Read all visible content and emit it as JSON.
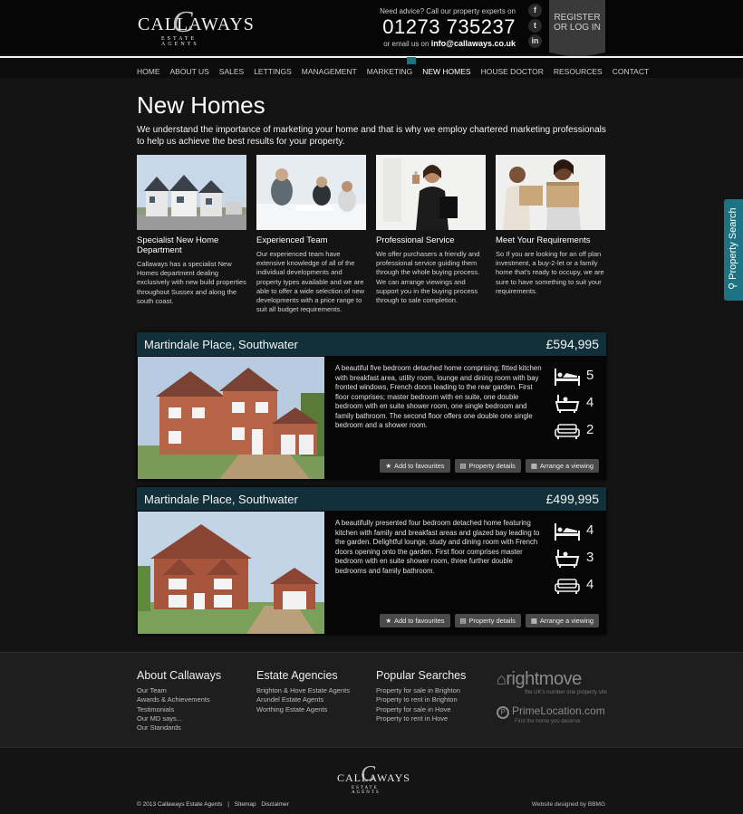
{
  "brand": {
    "logo_main": "CALLAWAYS",
    "logo_sub": "ESTATE AGENTS",
    "logo_swash": "C"
  },
  "header": {
    "advice": "Need advice? Call our property experts on",
    "phone": "01273 735237",
    "email_prefix": "or email us on",
    "email": "info@callaways.co.uk",
    "register_line1": "REGISTER",
    "register_line2": "OR LOG IN",
    "social": [
      "f",
      "t",
      "in"
    ]
  },
  "nav": {
    "items": [
      "HOME",
      "ABOUT US",
      "SALES",
      "LETTINGS",
      "MANAGEMENT",
      "MARKETING",
      "NEW HOMES",
      "HOUSE DOCTOR",
      "RESOURCES",
      "CONTACT"
    ],
    "active": "NEW HOMES"
  },
  "page": {
    "title": "New Homes",
    "intro": "We understand the importance of marketing your home and that is why we employ chartered marketing professionals to help us achieve the best results for your property."
  },
  "features": [
    {
      "title": "Specialist New Home Department",
      "text": "Callaways has a specialist New Homes department dealing exclusively with new build properties throughout Sussex and along the south coast."
    },
    {
      "title": "Experienced Team",
      "text": "Our experienced team have extensive knowledge of all of the individual developments and property types available and we are able to offer a wide selection of new developments with a price range to suit all budget requirements."
    },
    {
      "title": "Professional Service",
      "text": "We offer purchasers a friendly and professional service guiding them through the whole buying process. We can arrange viewings and support you in the buying process through to sale completion."
    },
    {
      "title": "Meet Your Requirements",
      "text": "So If you are looking for an off plan investment, a buy-2-let or a family home that's ready to occupy, we are sure to have something to suit your requirements."
    }
  ],
  "listings": [
    {
      "name": "Martindale Place, Southwater",
      "price": "£594,995",
      "description": "A beautiful five bedroom detached home comprising; fitted kitchen with breakfast area, utility room, lounge and dining room with bay fronted windows, French doors leading to the rear garden. First floor comprises; master bedroom with en suite, one double bedroom with en suite shower room, one single bedroom and family bathroom. The second floor offers one double one single bedroom and a shower room.",
      "bedrooms": "5",
      "bathrooms": "4",
      "receptions": "2"
    },
    {
      "name": "Martindale Place, Southwater",
      "price": "£499,995",
      "description": "A beautifully presented four bedroom detached home featuring kitchen with family and breakfast areas and glazed bay leading to the garden. Delightful lounge, study and dining room with French doors opening onto the garden. First floor comprises master bedroom with en suite shower room, three further double bedrooms and family bathroom.",
      "bedrooms": "4",
      "bathrooms": "3",
      "receptions": "4"
    }
  ],
  "listing_buttons": {
    "favourites": "Add to favourites",
    "details": "Property details",
    "viewing": "Arrange a viewing"
  },
  "footer": {
    "about": {
      "heading": "About Callaways",
      "links": [
        "Our Team",
        "Awards & Achievements",
        "Testimonials",
        "Our MD says...",
        "Our Standards"
      ]
    },
    "agencies": {
      "heading": "Estate Agencies",
      "links": [
        "Brighton & Hove Estate Agents",
        "Arundel Estate Agents",
        "Worthing Estate Agents"
      ]
    },
    "searches": {
      "heading": "Popular Searches",
      "links": [
        "Property for sale in Brighton",
        "Property to rent in Brighton",
        "Property for sale in Hove",
        "Property to rent in Hove"
      ]
    },
    "rightmove": "rightmove",
    "rightmove_tag": "the UK's number one property site",
    "primelocation": "PrimeLocation.com",
    "primelocation_tag": "Find the home you deserve"
  },
  "bottom": {
    "copyright": "© 2013 Callaways Estate Agents",
    "sitemap": "Sitemap",
    "disclaimer": "Disclaimer",
    "designed": "Website designed by BBMG"
  },
  "side_tab": {
    "label": "Property Search"
  },
  "colors": {
    "accent": "#1e7383",
    "card_header": "#12303a",
    "background": "#141414"
  }
}
